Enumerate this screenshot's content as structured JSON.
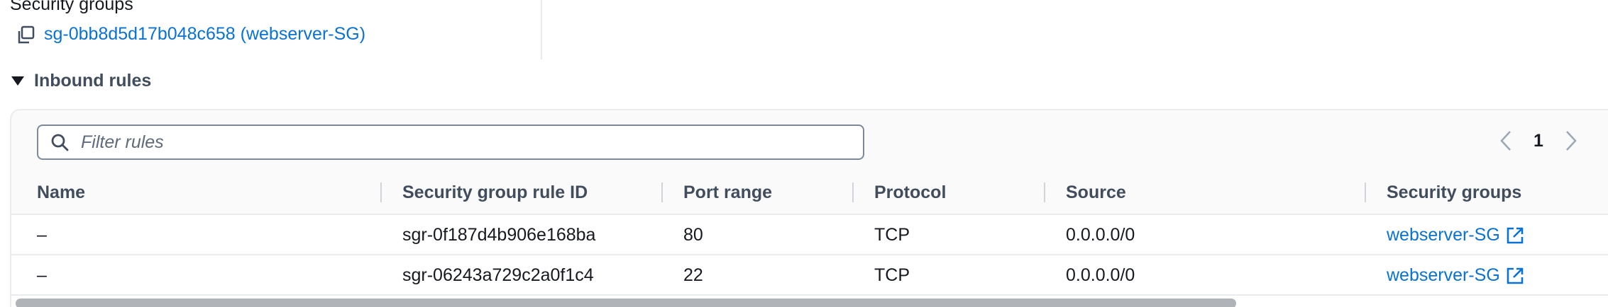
{
  "details": {
    "security_groups_label": "Security groups",
    "security_group_link": "sg-0bb8d5d17b048c658 (webserver-SG)"
  },
  "inbound": {
    "title": "Inbound rules",
    "expanded": true
  },
  "filter": {
    "placeholder": "Filter rules",
    "value": ""
  },
  "pagination": {
    "current_page": "1"
  },
  "table": {
    "columns": [
      "Name",
      "Security group rule ID",
      "Port range",
      "Protocol",
      "Source",
      "Security groups"
    ],
    "rows": [
      {
        "name": "–",
        "rule_id": "sgr-0f187d4b906e168ba",
        "port_range": "80",
        "protocol": "TCP",
        "source": "0.0.0.0/0",
        "security_group": "webserver-SG"
      },
      {
        "name": "–",
        "rule_id": "sgr-06243a729c2a0f1c4",
        "port_range": "22",
        "protocol": "TCP",
        "source": "0.0.0.0/0",
        "security_group": "webserver-SG"
      }
    ]
  },
  "icons": {
    "copy": "copy-icon",
    "search": "search-icon",
    "prev": "chevron-left-icon",
    "next": "chevron-right-icon",
    "external": "external-link-icon",
    "caret": "caret-down-icon"
  },
  "colors": {
    "link": "#0972d3",
    "text": "#16191f",
    "header_text": "#414d5c",
    "border": "#e9ebed"
  }
}
